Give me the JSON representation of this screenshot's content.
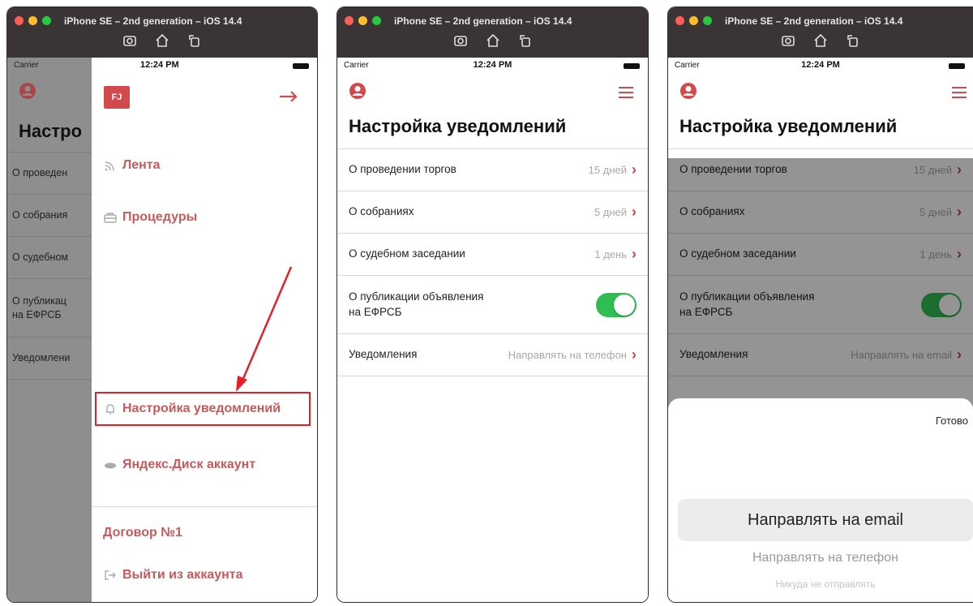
{
  "simulator": {
    "title": "iPhone SE – 2nd generation – iOS 14.4",
    "traffic_light_colors": [
      "#fe5f57",
      "#febc2e",
      "#28c840"
    ],
    "icons": [
      "screenshot-icon",
      "home-icon",
      "rotate-icon"
    ]
  },
  "status_bar": {
    "carrier": "Carrier",
    "time": "12:24 PM"
  },
  "screen1": {
    "behind_title": "Настро",
    "behind_rows": [
      "О проведен",
      "О собрания",
      "О судебном",
      "О публикац\nна ЕФРСБ",
      "Уведомлени"
    ],
    "logo": "FJ",
    "menu": [
      {
        "label": "Лента",
        "icon": "rss-icon"
      },
      {
        "label": "Процедуры",
        "icon": "briefcase-icon"
      },
      {
        "label": "Настройка уведомлений",
        "icon": "bell-icon"
      },
      {
        "label": "Яндекс.Диск аккаунт",
        "icon": "disk-icon"
      }
    ],
    "contract": "Договор №1",
    "logout": "Выйти из аккаунта",
    "accent": "#c95a5c",
    "highlight_color": "#e51f25"
  },
  "screen2": {
    "title": "Настройка уведомлений",
    "rows": [
      {
        "label": "О проведении торгов",
        "value": "15 дней"
      },
      {
        "label": "О собраниях",
        "value": "5 дней"
      },
      {
        "label": "О судебном заседании",
        "value": "1 день"
      },
      {
        "label": "О публикации объявления\nна ЕФРСБ",
        "toggle": true
      },
      {
        "label": "Уведомления",
        "value": "Направлять на телефон"
      }
    ]
  },
  "screen3": {
    "title": "Настройка уведомлений",
    "rows": [
      {
        "label": "О проведении торгов",
        "value": "15 дней"
      },
      {
        "label": "О собраниях",
        "value": "5 дней"
      },
      {
        "label": "О судебном заседании",
        "value": "1 день"
      },
      {
        "label": "О публикации объявления\nна ЕФРСБ",
        "toggle": true
      },
      {
        "label": "Уведомления",
        "value": "Направлять на email"
      }
    ],
    "picker": {
      "done": "Готово",
      "selected": "Направлять на email",
      "option": "Направлять на телефон",
      "option2": "Никуда не отправлять"
    }
  }
}
